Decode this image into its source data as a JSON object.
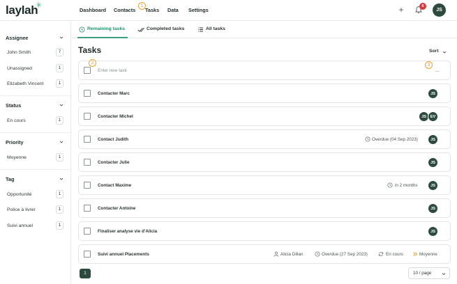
{
  "app": {
    "logo": "laylah",
    "logo_mark": "✳"
  },
  "nav": {
    "items": [
      "Dashboard",
      "Contacts",
      "Tasks",
      "Data",
      "Settings"
    ],
    "notification_count": "6",
    "user_initials": "JS"
  },
  "markers": [
    "1",
    "2",
    "3"
  ],
  "sidebar": {
    "assignee": {
      "title": "Assignee",
      "items": [
        {
          "label": "John Smith",
          "count": "7"
        },
        {
          "label": "Unassigned",
          "count": "1"
        },
        {
          "label": "Elizabeth Vincent",
          "count": "1"
        }
      ]
    },
    "status": {
      "title": "Status",
      "items": [
        {
          "label": "En cours",
          "count": "1"
        }
      ]
    },
    "priority": {
      "title": "Priority",
      "items": [
        {
          "label": "Moyenne",
          "count": "1"
        }
      ]
    },
    "tag": {
      "title": "Tag",
      "items": [
        {
          "label": "Opportunité",
          "count": "1"
        },
        {
          "label": "Police à livrer",
          "count": "1"
        },
        {
          "label": "Suivi annuel",
          "count": "1"
        }
      ]
    }
  },
  "tabs": [
    "Remaining tasks",
    "Completed tasks",
    "All tasks"
  ],
  "main": {
    "title": "Tasks",
    "sort_label": "Sort",
    "new_task_placeholder": "Enter new task",
    "new_task_more": "..."
  },
  "tasks": [
    {
      "label": "Contacter Marc",
      "avatars": [
        "JS"
      ]
    },
    {
      "label": "Contacter Michel",
      "avatars": [
        "JS",
        "EV"
      ]
    },
    {
      "label": "Contact Judith",
      "due": "Overdue (04 Sep 2023)",
      "avatars": [
        "JS"
      ]
    },
    {
      "label": "Contacter Julie",
      "avatars": [
        "JS"
      ]
    },
    {
      "label": "Contact Maxime",
      "due": "in 2 months",
      "avatars": [
        "JS"
      ]
    },
    {
      "label": "Contacter Antoine",
      "avatars": [
        "JS"
      ]
    },
    {
      "label": "Finaliser analyse vie d'Alicia",
      "avatars": [
        "JS"
      ]
    },
    {
      "label": "Suivi annuel Placements",
      "contact": "Alicia Dillan",
      "due": "Overdue (27 Sep 2023)",
      "status": "En cours",
      "priority": "Moyenne"
    }
  ],
  "pagination": {
    "current_page": "1",
    "page_size": "10 / page"
  },
  "colors": {
    "accent": "#2f8a6a",
    "avatar": "#2c4b3e",
    "badge": "#d63b3b",
    "marker": "#f0a030"
  }
}
